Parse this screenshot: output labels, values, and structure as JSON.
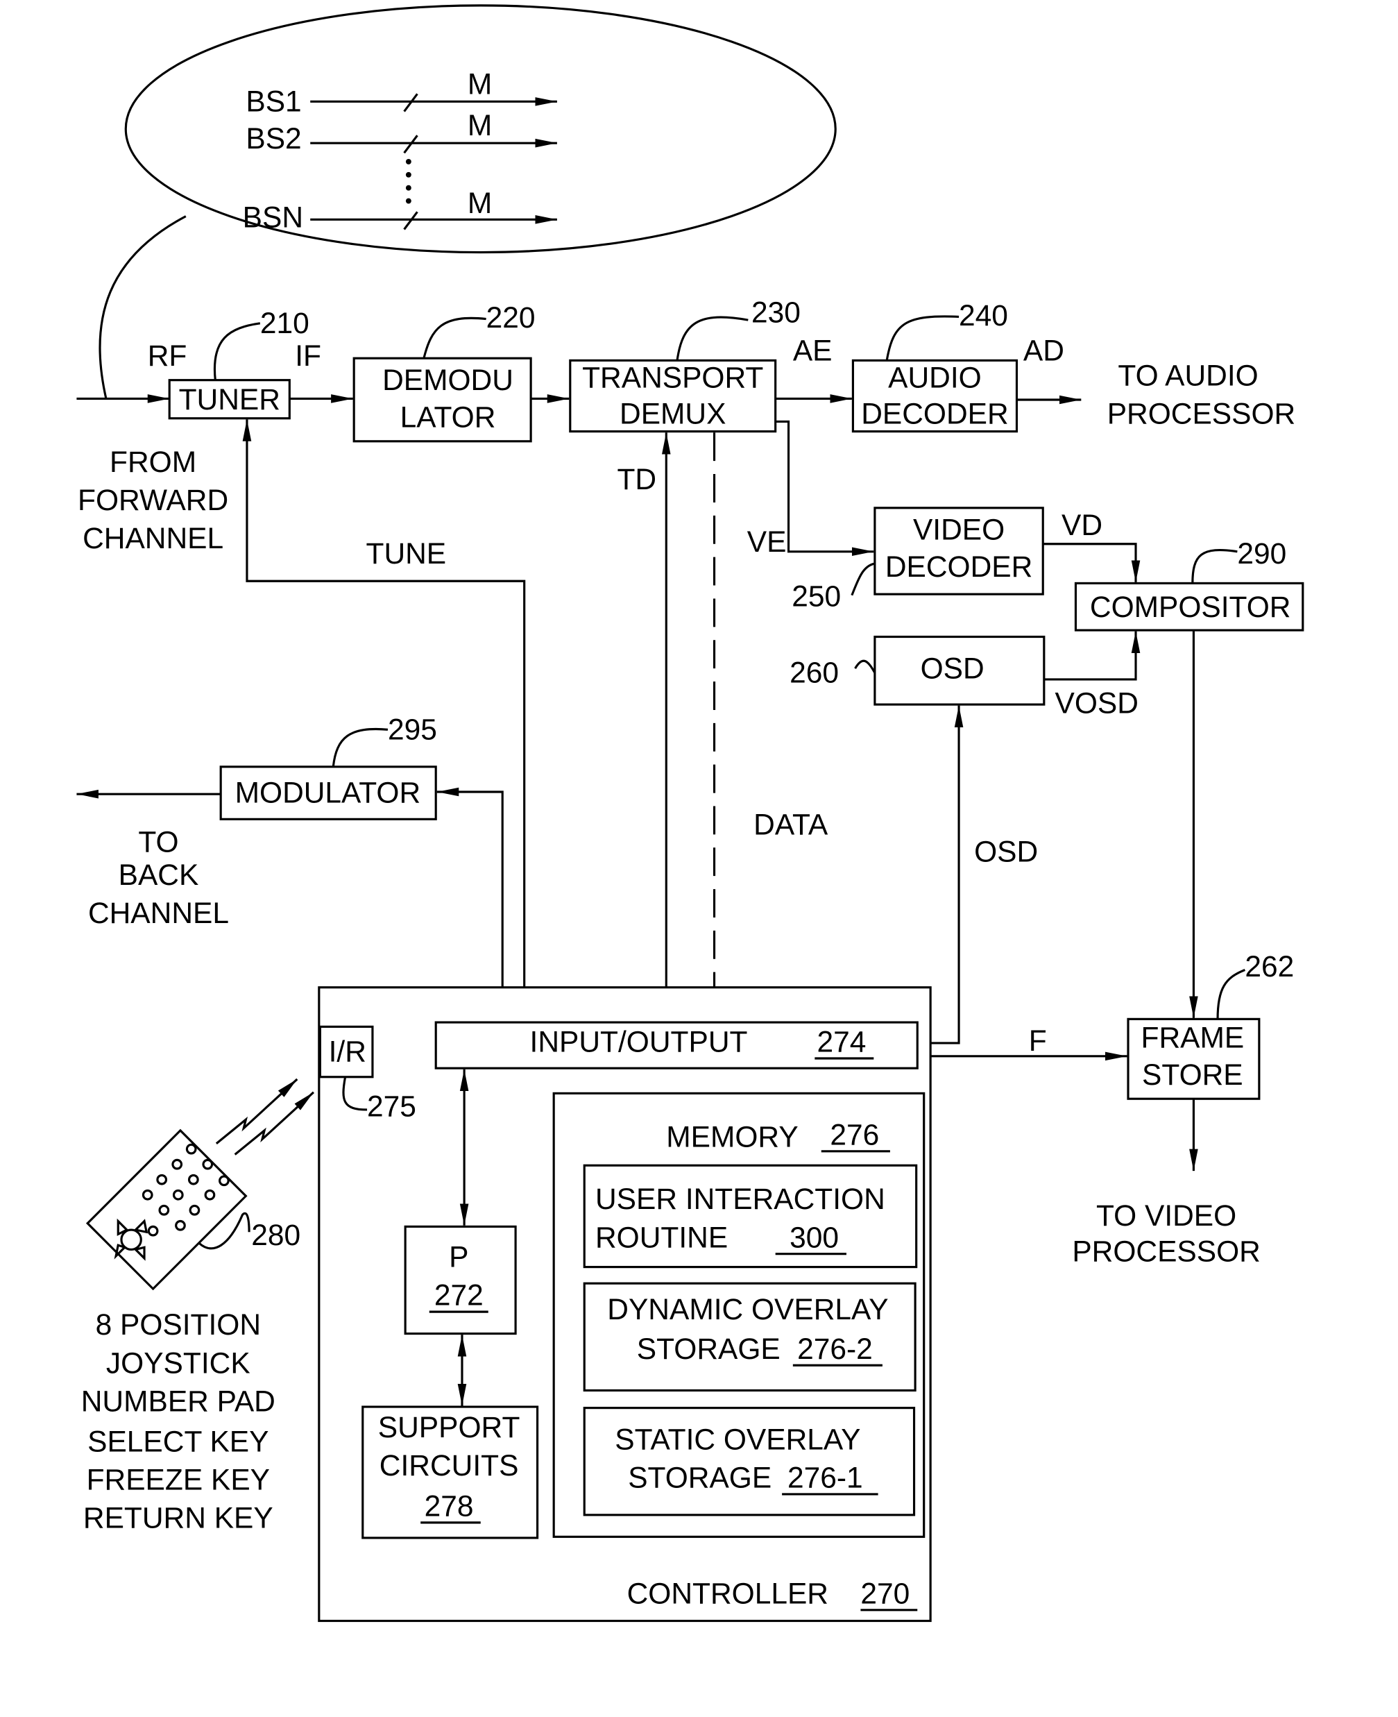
{
  "figure": {
    "bitstream_inputs": [
      {
        "label": "BS1",
        "bus_width": "M"
      },
      {
        "label": "BS2",
        "bus_width": "M"
      },
      {
        "label": "BSN",
        "bus_width": "M"
      }
    ],
    "blocks": {
      "tuner": {
        "lines": [
          "TUNER"
        ],
        "ref": "210"
      },
      "demodulator": {
        "lines": [
          "DEMODU",
          "LATOR"
        ],
        "ref": "220"
      },
      "transport_demux": {
        "lines": [
          "TRANSPORT",
          "DEMUX"
        ],
        "ref": "230"
      },
      "audio_decoder": {
        "lines": [
          "AUDIO",
          "DECODER"
        ],
        "ref": "240"
      },
      "video_decoder": {
        "lines": [
          "VIDEO",
          "DECODER"
        ],
        "ref": "250"
      },
      "osd": {
        "lines": [
          "OSD"
        ],
        "ref": "260"
      },
      "compositor": {
        "lines": [
          "COMPOSITOR"
        ],
        "ref": "290"
      },
      "modulator": {
        "lines": [
          "MODULATOR"
        ],
        "ref": "295"
      },
      "frame_store": {
        "lines": [
          "FRAME",
          "STORE"
        ],
        "ref": "262"
      },
      "ir_receiver": {
        "lines": [
          "I/R"
        ],
        "ref": "275"
      },
      "input_output": {
        "label": "INPUT/OUTPUT",
        "ref": "274"
      },
      "processor": {
        "label": "P",
        "ref": "272"
      },
      "support_circuits": {
        "lines": [
          "SUPPORT",
          "CIRCUITS"
        ],
        "ref": "278"
      },
      "memory": {
        "label": "MEMORY",
        "ref": "276"
      },
      "user_interaction_routine": {
        "lines": [
          "USER INTERACTION",
          "ROUTINE"
        ],
        "ref": "300"
      },
      "dynamic_overlay_storage": {
        "lines": [
          "DYNAMIC OVERLAY",
          "STORAGE"
        ],
        "ref": "276-2"
      },
      "static_overlay_storage": {
        "lines": [
          "STATIC OVERLAY",
          "STORAGE"
        ],
        "ref": "276-1"
      },
      "controller": {
        "label": "CONTROLLER",
        "ref": "270"
      },
      "remote_control": {
        "ref": "280"
      }
    },
    "signals": {
      "rf": "RF",
      "if": "IF",
      "ae": "AE",
      "ad": "AD",
      "td": "TD",
      "ve": "VE",
      "vd": "VD",
      "vosd": "VOSD",
      "tune": "TUNE",
      "data": "DATA",
      "osd": "OSD",
      "f": "F"
    },
    "external": {
      "from_forward_channel": [
        "FROM",
        "FORWARD",
        "CHANNEL"
      ],
      "to_audio_processor": [
        "TO AUDIO",
        "PROCESSOR"
      ],
      "to_back_channel": [
        "TO",
        "BACK",
        "CHANNEL"
      ],
      "to_video_processor": [
        "TO VIDEO",
        "PROCESSOR"
      ]
    },
    "remote_features": [
      "8 POSITION",
      "JOYSTICK",
      "NUMBER PAD",
      "SELECT KEY",
      "FREEZE KEY",
      "RETURN KEY"
    ]
  }
}
